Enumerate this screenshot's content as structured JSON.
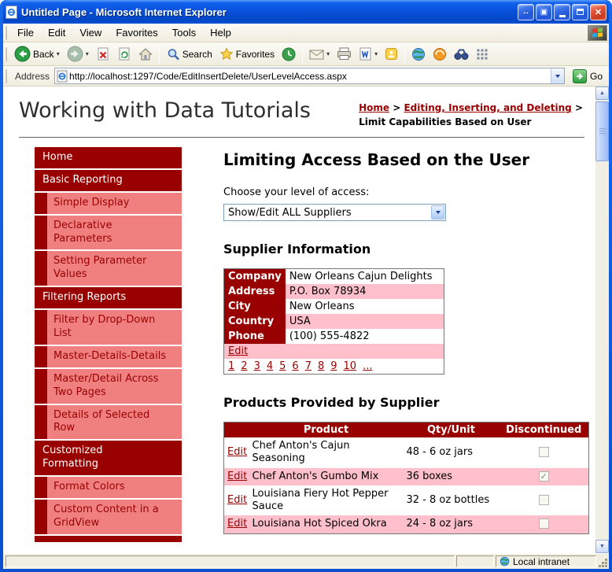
{
  "window": {
    "title": "Untitled Page - Microsoft Internet Explorer",
    "status_zone": "Local intranet"
  },
  "menu": {
    "items": [
      "File",
      "Edit",
      "View",
      "Favorites",
      "Tools",
      "Help"
    ]
  },
  "toolbar": {
    "back_label": "Back",
    "search_label": "Search",
    "favorites_label": "Favorites"
  },
  "address": {
    "label": "Address",
    "url": "http://localhost:1297/Code/EditInsertDelete/UserLevelAccess.aspx",
    "go_label": "Go"
  },
  "header": {
    "site_title": "Working with Data Tutorials",
    "breadcrumb": {
      "home": "Home",
      "separator": ">",
      "section": "Editing, Inserting, and Deleting",
      "current": "Limit Capabilities Based on User"
    }
  },
  "sidebar": {
    "items": [
      {
        "label": "Home",
        "type": "category"
      },
      {
        "label": "Basic Reporting",
        "type": "category"
      },
      {
        "label": "Simple Display",
        "type": "sub"
      },
      {
        "label": "Declarative Parameters",
        "type": "sub"
      },
      {
        "label": "Setting Parameter Values",
        "type": "sub"
      },
      {
        "label": "Filtering Reports",
        "type": "category"
      },
      {
        "label": "Filter by Drop-Down List",
        "type": "sub"
      },
      {
        "label": "Master-Details-Details",
        "type": "sub"
      },
      {
        "label": "Master/Detail Across Two Pages",
        "type": "sub"
      },
      {
        "label": "Details of Selected Row",
        "type": "sub"
      },
      {
        "label": "Customized Formatting",
        "type": "category"
      },
      {
        "label": "Format Colors",
        "type": "sub"
      },
      {
        "label": "Custom Content in a GridView",
        "type": "sub"
      }
    ]
  },
  "main": {
    "heading": "Limiting Access Based on the User",
    "access_label": "Choose your level of access:",
    "access_value": "Show/Edit ALL Suppliers",
    "supplier_heading": "Supplier Information",
    "supplier": {
      "rows": [
        {
          "label": "Company",
          "value": "New Orleans Cajun Delights"
        },
        {
          "label": "Address",
          "value": "P.O. Box 78934"
        },
        {
          "label": "City",
          "value": "New Orleans"
        },
        {
          "label": "Country",
          "value": "USA"
        },
        {
          "label": "Phone",
          "value": "(100) 555-4822"
        }
      ],
      "edit_label": "Edit",
      "pager": [
        "1",
        "2",
        "3",
        "4",
        "5",
        "6",
        "7",
        "8",
        "9",
        "10",
        "..."
      ]
    },
    "products_heading": "Products Provided by Supplier",
    "products": {
      "headers": {
        "edit": "",
        "product": "Product",
        "qty": "Qty/Unit",
        "discontinued": "Discontinued"
      },
      "rows": [
        {
          "edit": "Edit",
          "product": "Chef Anton's Cajun Seasoning",
          "qty": "48 - 6 oz jars",
          "discontinued": false
        },
        {
          "edit": "Edit",
          "product": "Chef Anton's Gumbo Mix",
          "qty": "36 boxes",
          "discontinued": true
        },
        {
          "edit": "Edit",
          "product": "Louisiana Fiery Hot Pepper Sauce",
          "qty": "32 - 8 oz bottles",
          "discontinued": false
        },
        {
          "edit": "Edit",
          "product": "Louisiana Hot Spiced Okra",
          "qty": "24 - 8 oz jars",
          "discontinued": false
        }
      ]
    }
  },
  "colors": {
    "maroon": "#990000",
    "sidebar_pink": "#F08080",
    "row_pink": "#FFC0CB",
    "titlebar_blue": "#0A53DE"
  }
}
